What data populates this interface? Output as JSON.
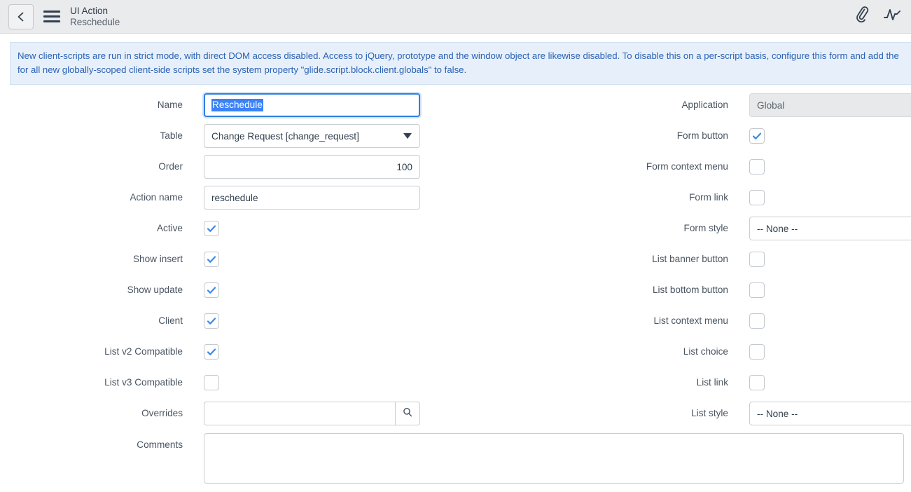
{
  "header": {
    "back_icon": "chevron-left-icon",
    "menu_icon": "hamburger-menu-icon",
    "kicker": "UI Action",
    "record_name": "Reschedule",
    "attachment_icon": "paperclip-icon",
    "activity_icon": "activity-pulse-icon"
  },
  "banner": {
    "line1": "New client-scripts are run in strict mode, with direct DOM access disabled. Access to jQuery, prototype and the window object are likewise disabled. To disable this on a per-script basis, configure this form and add the",
    "line2": "for all new globally-scoped client-side scripts set the system property \"glide.script.block.client.globals\" to false.",
    "text_color": "#2a61b5",
    "background_color": "#e7f0fa"
  },
  "form": {
    "left": {
      "name": {
        "label": "Name",
        "value": "Reschedule",
        "selected": true,
        "focused": true
      },
      "table": {
        "label": "Table",
        "value": "Change Request [change_request]"
      },
      "order": {
        "label": "Order",
        "value": "100"
      },
      "action_name": {
        "label": "Action name",
        "value": "reschedule"
      },
      "active": {
        "label": "Active",
        "checked": true
      },
      "show_insert": {
        "label": "Show insert",
        "checked": true
      },
      "show_update": {
        "label": "Show update",
        "checked": true
      },
      "client": {
        "label": "Client",
        "checked": true
      },
      "list_v2_compatible": {
        "label": "List v2 Compatible",
        "checked": true
      },
      "list_v3_compatible": {
        "label": "List v3 Compatible",
        "checked": false
      },
      "overrides": {
        "label": "Overrides",
        "value": "",
        "search_icon": "magnifier-icon"
      },
      "comments": {
        "label": "Comments",
        "value": ""
      }
    },
    "right": {
      "application": {
        "label": "Application",
        "value": "Global",
        "readonly": true
      },
      "form_button": {
        "label": "Form button",
        "checked": true
      },
      "form_context_menu": {
        "label": "Form context menu",
        "checked": false
      },
      "form_link": {
        "label": "Form link",
        "checked": false
      },
      "form_style": {
        "label": "Form style",
        "value": "-- None --"
      },
      "list_banner_button": {
        "label": "List banner button",
        "checked": false
      },
      "list_bottom_button": {
        "label": "List bottom button",
        "checked": false
      },
      "list_context_menu": {
        "label": "List context menu",
        "checked": false
      },
      "list_choice": {
        "label": "List choice",
        "checked": false
      },
      "list_link": {
        "label": "List link",
        "checked": false
      },
      "list_style": {
        "label": "List style",
        "value": "-- None --"
      }
    }
  },
  "colors": {
    "header_bg": "#e9ebed",
    "accent_blue": "#3b82f6",
    "focus_border": "#2f7fe0",
    "checkmark": "#3c8ae8"
  }
}
